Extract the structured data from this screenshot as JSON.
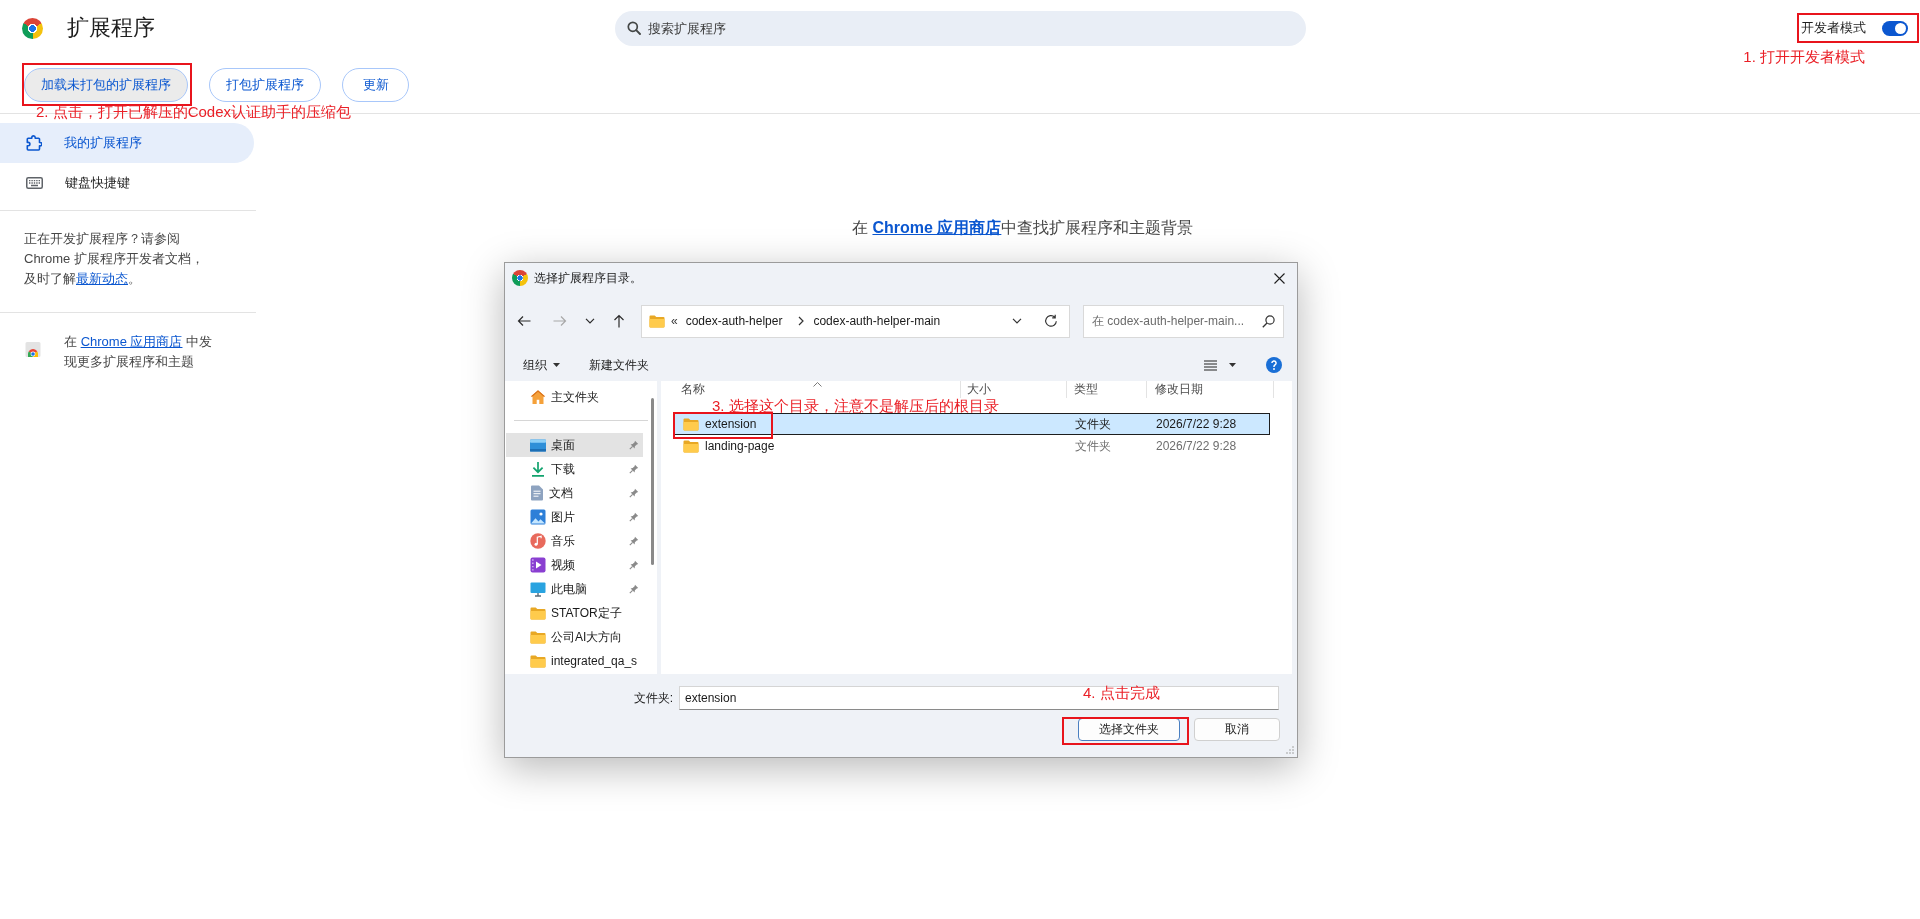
{
  "header": {
    "title": "扩展程序",
    "search": {
      "placeholder": "搜索扩展程序"
    },
    "developer_mode": {
      "label": "开发者模式",
      "on": true,
      "highlighted": true,
      "annotation": "1. 打开开发者模式"
    }
  },
  "actions": {
    "buttons": [
      {
        "label": "加载未打包的扩展程序",
        "hovered": true,
        "highlighted": true
      },
      {
        "label": "打包扩展程序",
        "hovered": false,
        "highlighted": false
      },
      {
        "label": "更新",
        "hovered": false,
        "highlighted": false
      }
    ],
    "annotation": "2. 点击，打开已解压的Codex认证助手的压缩包"
  },
  "sidebar": {
    "items": [
      {
        "label": "我的扩展程序",
        "selected": true
      },
      {
        "label": "键盘快捷键",
        "selected": false
      }
    ],
    "developer_note": {
      "text": "正在开发扩展程序？请参阅 Chrome 扩展程序开发者文档，及时了解",
      "link": "最新动态",
      "after": "。"
    },
    "store_note": {
      "before": "在 ",
      "link": "Chrome 应用商店",
      "after": " 中发现更多扩展程序和主题"
    }
  },
  "main": {
    "message": {
      "before": "在 ",
      "link": "Chrome 应用商店",
      "after": "中查找扩展程序和主题背景"
    }
  },
  "dialog": {
    "title": "选择扩展程序目录。",
    "navigation": [
      {
        "kind": "back",
        "disabled": false
      },
      {
        "kind": "forward",
        "disabled": true
      },
      {
        "kind": "recent",
        "disabled": false
      },
      {
        "kind": "up",
        "disabled": false
      }
    ],
    "address": {
      "overflow": "«",
      "path": [
        "codex-auth-helper",
        "codex-auth-helper-main"
      ]
    },
    "search": {
      "placeholder": "在 codex-auth-helper-main..."
    },
    "commands": {
      "organize": "组织",
      "new_folder": "新建文件夹"
    },
    "nav_pane": {
      "groups": [
        {
          "items": [
            {
              "kind": "home",
              "label": "主文件夹",
              "pinned": false,
              "selected": false
            }
          ]
        },
        {
          "items": [
            {
              "kind": "desktop",
              "label": "桌面",
              "pinned": true,
              "selected": true
            },
            {
              "kind": "downloads",
              "label": "下载",
              "pinned": true,
              "selected": false
            },
            {
              "kind": "documents",
              "label": "文档",
              "pinned": true,
              "selected": false
            },
            {
              "kind": "pictures",
              "label": "图片",
              "pinned": true,
              "selected": false
            },
            {
              "kind": "music",
              "label": "音乐",
              "pinned": true,
              "selected": false
            },
            {
              "kind": "videos",
              "label": "视频",
              "pinned": true,
              "selected": false
            },
            {
              "kind": "computer",
              "label": "此电脑",
              "pinned": true,
              "selected": false
            },
            {
              "kind": "folder",
              "label": "STATOR定子",
              "pinned": false,
              "selected": false
            },
            {
              "kind": "folder",
              "label": "公司AI大方向",
              "pinned": false,
              "selected": false
            },
            {
              "kind": "folder",
              "label": "integrated_qa_s",
              "pinned": false,
              "selected": false
            }
          ]
        }
      ]
    },
    "columns": [
      {
        "label": "名称",
        "sorted": true
      },
      {
        "label": "大小",
        "sorted": false
      },
      {
        "label": "类型",
        "sorted": false
      },
      {
        "label": "修改日期",
        "sorted": false
      }
    ],
    "list_annotation": "3. 选择这个目录，注意不是解压后的根目录",
    "files": [
      {
        "name": "extension",
        "type": "文件夹",
        "modified": "2026/7/22 9:28",
        "selected": true,
        "highlighted": true
      },
      {
        "name": "landing-page",
        "type": "文件夹",
        "modified": "2026/7/22 9:28",
        "selected": false,
        "highlighted": false
      }
    ],
    "folder_field": {
      "label": "文件夹:",
      "value": "extension"
    },
    "footer_annotation": "4. 点击完成",
    "buttons": [
      {
        "label": "选择文件夹",
        "default": true,
        "highlighted": true
      },
      {
        "label": "取消",
        "default": false,
        "highlighted": false
      }
    ]
  }
}
